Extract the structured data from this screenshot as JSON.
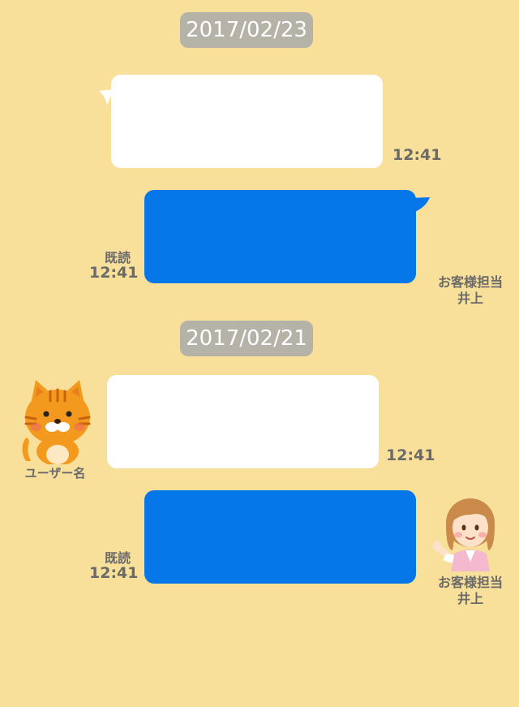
{
  "conversation": [
    {
      "date": "2017/02/23",
      "incoming": {
        "time": "12:41",
        "sender": null
      },
      "outgoing": {
        "read": "既読",
        "time": "12:41",
        "agent_name_line1": "お客様担当",
        "agent_name_line2": "井上"
      }
    },
    {
      "date": "2017/02/21",
      "incoming": {
        "time": "12:41",
        "sender": "ユーザー名"
      },
      "outgoing": {
        "read": "既読",
        "time": "12:41",
        "agent_name_line1": "お客様担当",
        "agent_name_line2": "井上"
      }
    }
  ],
  "colors": {
    "background": "#f8e09a",
    "incoming_bubble": "#ffffff",
    "outgoing_bubble": "#0677e9",
    "date_badge": "#b5b3a8",
    "meta_text": "#6a6a6a"
  },
  "icons": {
    "user_avatar": "cat-avatar-icon",
    "agent_avatar": "agent-woman-avatar-icon"
  }
}
